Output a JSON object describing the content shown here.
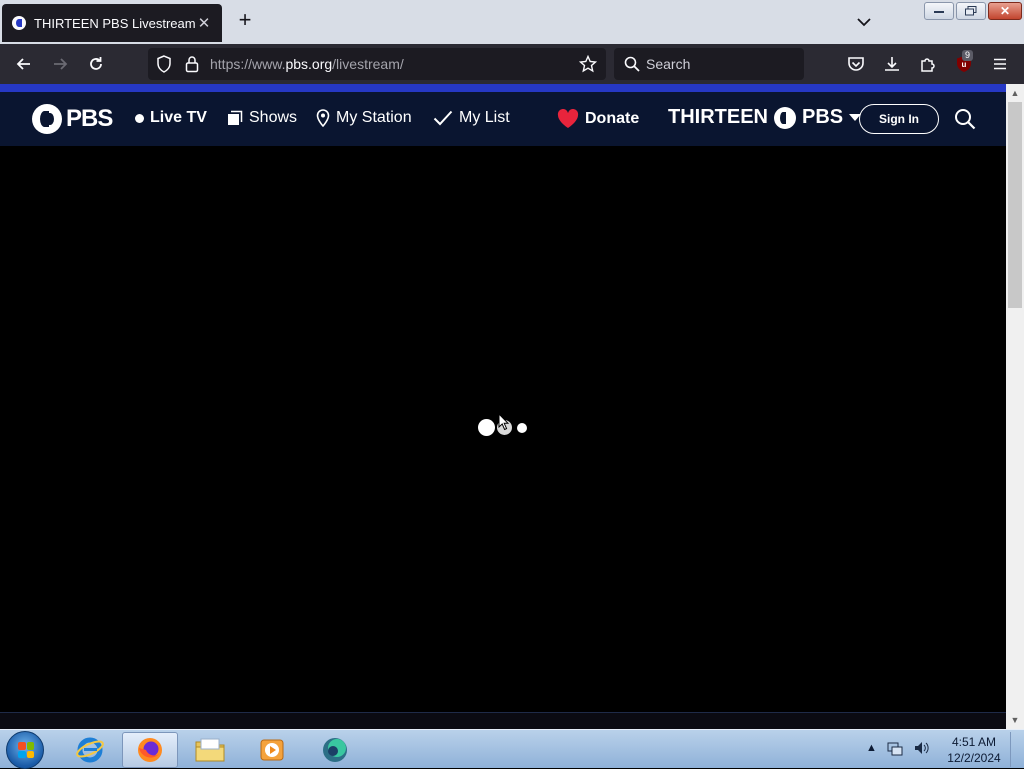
{
  "browser": {
    "tab_title": "THIRTEEN PBS Livestream",
    "tab_close": "✕",
    "new_tab": "+",
    "url_prefix": "https://www.",
    "url_host": "pbs.org",
    "url_path": "/livestream/",
    "search_placeholder": "Search",
    "extension_badge": "9",
    "window_close": "✕"
  },
  "pbs_nav": {
    "logo_text": "PBS",
    "live_tv": "Live TV",
    "shows": "Shows",
    "my_station": "My Station",
    "my_list": "My List",
    "donate": "Donate",
    "station_name": "THIRTEEN",
    "station_brand": "PBS",
    "sign_in": "Sign In"
  },
  "player": {
    "status": "loading"
  },
  "taskbar": {
    "time": "4:51 AM",
    "date": "12/2/2024"
  },
  "colors": {
    "pbs_blue": "#2638c4",
    "pbs_navy": "#0a1530",
    "donate_heart": "#e8243c"
  }
}
